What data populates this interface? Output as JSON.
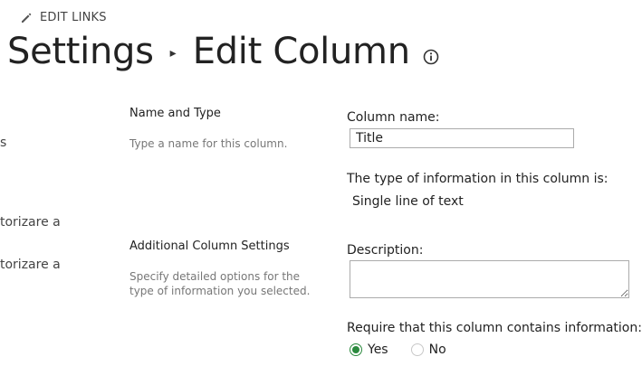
{
  "header": {
    "edit_links": "EDIT LINKS",
    "title_part1": "Settings",
    "title_separator": "▸",
    "title_part2": "Edit Column"
  },
  "left_nav": {
    "items": [
      "s",
      "torizare a",
      "torizare a"
    ]
  },
  "sections": {
    "name_type": {
      "title": "Name and Type",
      "description": "Type a name for this column."
    },
    "additional": {
      "title": "Additional Column Settings",
      "description": "Specify detailed options for the type of information you selected."
    }
  },
  "form": {
    "column_name_label": "Column name:",
    "column_name_value": "Title",
    "type_label": "The type of information in this column is:",
    "type_value": "Single line of text",
    "description_label": "Description:",
    "description_value": "",
    "require_label": "Require that this column contains information:",
    "require_options": [
      "Yes",
      "No"
    ],
    "require_selected": "Yes"
  },
  "colors": {
    "accent_green": "#2b8a3e",
    "text_dark": "#222222",
    "text_muted": "#777777"
  }
}
